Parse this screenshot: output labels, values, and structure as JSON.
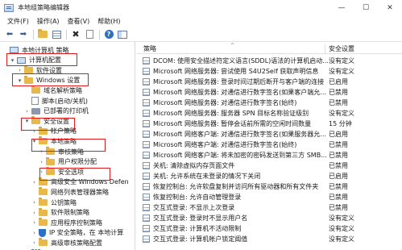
{
  "window": {
    "title": "本地组策略编辑器",
    "minimize": "—",
    "maximize": "☐",
    "close": "✕"
  },
  "menu": [
    "文件(F)",
    "操作(A)",
    "查看(V)",
    "帮助(H)"
  ],
  "toolbar": {
    "icons": [
      "back-arrow-icon",
      "forward-arrow-icon",
      "folder-up-icon",
      "show-hide-tree-icon",
      "delete-icon",
      "properties-icon",
      "help-icon",
      "action-pane-icon"
    ],
    "back": "⬅",
    "forward": "➡",
    "delete": "✖",
    "help": "?"
  },
  "tree": [
    {
      "label": "本地计算机 策略",
      "depth": 0,
      "twisty": "",
      "icon": "pc"
    },
    {
      "label": "计算机配置",
      "depth": 1,
      "twisty": "▾",
      "icon": "pc"
    },
    {
      "label": "软件设置",
      "depth": 2,
      "twisty": "›",
      "icon": "folder"
    },
    {
      "label": "Windows 设置",
      "depth": 2,
      "twisty": "▾",
      "icon": "folder"
    },
    {
      "label": "域名解析策略",
      "depth": 3,
      "twisty": "",
      "icon": "folder"
    },
    {
      "label": "脚本(启动/关机)",
      "depth": 3,
      "twisty": "",
      "icon": "doc"
    },
    {
      "label": "已部署的打印机",
      "depth": 3,
      "twisty": "›",
      "icon": "printer"
    },
    {
      "label": "安全设置",
      "depth": 3,
      "twisty": "▾",
      "icon": "folder"
    },
    {
      "label": "帐户策略",
      "depth": 4,
      "twisty": "›",
      "icon": "folder"
    },
    {
      "label": "本地策略",
      "depth": 4,
      "twisty": "▾",
      "icon": "folder"
    },
    {
      "label": "审核策略",
      "depth": 5,
      "twisty": "›",
      "icon": "folder"
    },
    {
      "label": "用户权限分配",
      "depth": 5,
      "twisty": "›",
      "icon": "folder"
    },
    {
      "label": "安全选项",
      "depth": 5,
      "twisty": "›",
      "icon": "folder"
    },
    {
      "label": "高级安全 Windows Defen",
      "depth": 4,
      "twisty": "›",
      "icon": "folder"
    },
    {
      "label": "网络列表管理器策略",
      "depth": 4,
      "twisty": "",
      "icon": "folder"
    },
    {
      "label": "公钥策略",
      "depth": 4,
      "twisty": "›",
      "icon": "folder"
    },
    {
      "label": "软件限制策略",
      "depth": 4,
      "twisty": "›",
      "icon": "folder"
    },
    {
      "label": "应用程序控制策略",
      "depth": 4,
      "twisty": "›",
      "icon": "folder"
    },
    {
      "label": "IP 安全策略，在 本地计算",
      "depth": 4,
      "twisty": "›",
      "icon": "shield"
    },
    {
      "label": "高级审核策略配置",
      "depth": 4,
      "twisty": "›",
      "icon": "folder"
    },
    {
      "label": "基于策略的 QoS",
      "depth": 3,
      "twisty": "›",
      "icon": "chart"
    }
  ],
  "columns": {
    "policy": "策略",
    "setting": "安全设置"
  },
  "policies": [
    {
      "name": "DCOM: 使用安全描述符定义语言(SDDL)语法的计算机启动...",
      "setting": "没有定义"
    },
    {
      "name": "Microsoft 网络服务器: 尝试使用 S4U2Self 获取声明信息",
      "setting": "没有定义"
    },
    {
      "name": "Microsoft 网络服务器: 登录时间过期后断开与客户端的连接",
      "setting": "已启用"
    },
    {
      "name": "Microsoft 网络服务器: 对通信进行数字签名(如果客户端允...",
      "setting": "已禁用"
    },
    {
      "name": "Microsoft 网络服务器: 对通信进行数字签名(始终)",
      "setting": "已禁用"
    },
    {
      "name": "Microsoft 网络服务器: 服务器 SPN 目标名称验证级别",
      "setting": "没有定义"
    },
    {
      "name": "Microsoft 网络服务器: 暂停会话前所需的空闲时间数量",
      "setting": "15 分钟"
    },
    {
      "name": "Microsoft 网络客户端: 对通信进行数字签名(如果服务器允...",
      "setting": "已启用"
    },
    {
      "name": "Microsoft 网络客户端: 对通信进行数字签名(始终)",
      "setting": "已禁用"
    },
    {
      "name": "Microsoft 网络客户端: 将未加密的密码发送到第三方 SMB...",
      "setting": "已禁用"
    },
    {
      "name": "关机: 清除虚拟内存页面文件",
      "setting": "已禁用"
    },
    {
      "name": "关机: 允许系统在未登录的情况下关闭",
      "setting": "已启用"
    },
    {
      "name": "恢复控制台: 允许软盘复制并访问所有驱动器和所有文件夹",
      "setting": "已禁用"
    },
    {
      "name": "恢复控制台: 允许自动管理登录",
      "setting": "已禁用"
    },
    {
      "name": "交互式登录: 不显示上次登录",
      "setting": "已禁用"
    },
    {
      "name": "交互式登录: 登录时不显示用户名",
      "setting": "没有定义"
    },
    {
      "name": "交互式登录: 计算机不活动限制",
      "setting": "没有定义"
    },
    {
      "name": "交互式登录: 计算机帐户锁定阈值",
      "setting": "没有定义"
    }
  ]
}
